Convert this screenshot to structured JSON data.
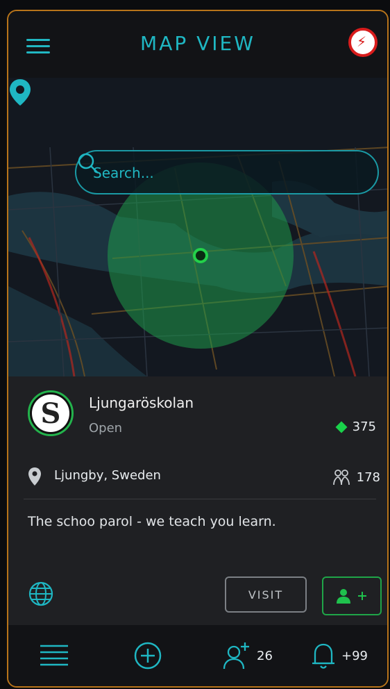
{
  "header": {
    "title": "MAP VIEW"
  },
  "search": {
    "placeholder": "Search..."
  },
  "school": {
    "name": "Ljungaröskolan",
    "status": "Open",
    "points": "375",
    "location": "Ljungby, Sweden",
    "members": "178",
    "description": "The schoo parol - we teach you learn.",
    "logo_letter": "S"
  },
  "actions": {
    "visit_label": "VISIT"
  },
  "bottom_nav": {
    "friend_requests": "26",
    "notifications": "+99"
  },
  "colors": {
    "accent": "#1fb7c3",
    "frame": "#b8741a",
    "green": "#23b34c",
    "avatar_ring": "#d81c1c"
  },
  "icons": [
    "menu-icon",
    "avatar",
    "location-pin-icon",
    "search-icon",
    "selected-location-marker",
    "points-diamond-icon",
    "members-icon",
    "globe-icon",
    "add-member-icon",
    "list-icon",
    "add-circle-icon",
    "add-friend-icon",
    "bell-icon"
  ]
}
